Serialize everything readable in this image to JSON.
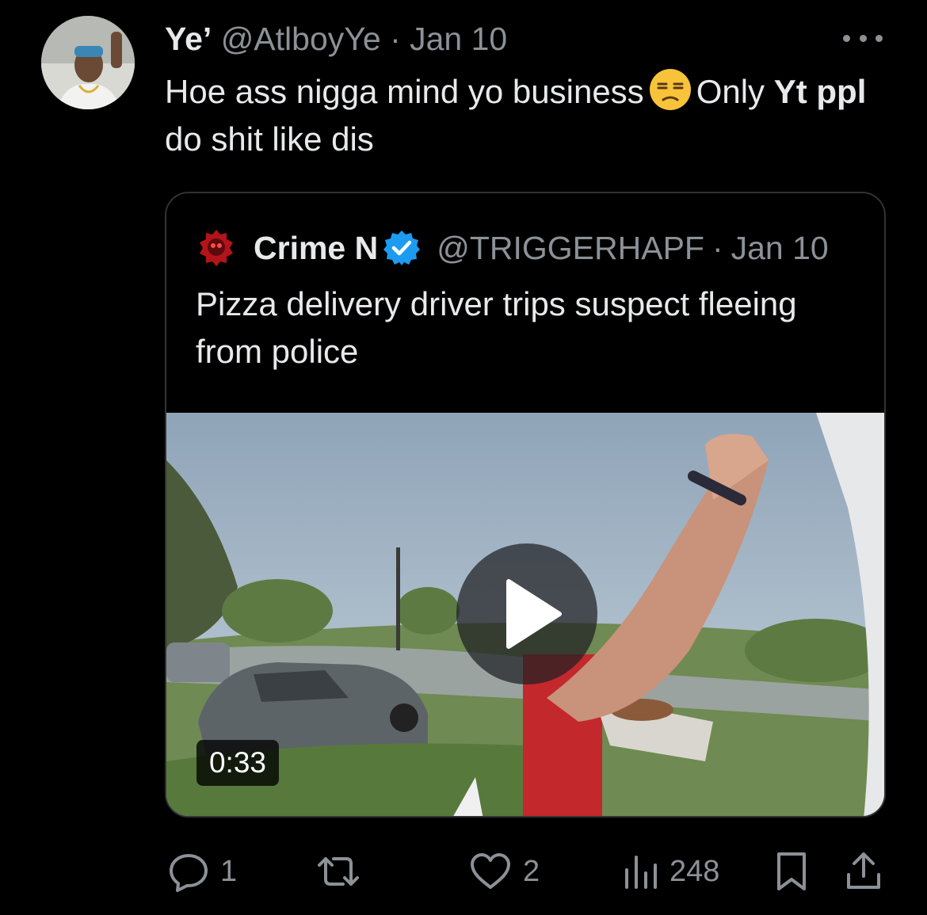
{
  "tweet": {
    "author_name": "Ye’",
    "author_handle": "@AtlboyYe",
    "separator": "·",
    "date": "Jan 10",
    "text_part1": "Hoe ass nigga mind yo business",
    "emoji": "unamused-face-emoji",
    "text_part2": "Only",
    "text_bold1": "Yt",
    "text_bold2": "ppl",
    "text_part3": "do shit like dis"
  },
  "quoted_tweet": {
    "author_name": "Crime N",
    "author_handle": "@TRIGGERHAPF",
    "separator": "·",
    "date": "Jan 10",
    "text": "Pizza delivery driver trips suspect fleeing from police",
    "video_duration": "0:33"
  },
  "actions": {
    "replies": "1",
    "likes": "2",
    "views": "248"
  },
  "icons": [
    "more-icon",
    "verified-badge-icon",
    "play-icon",
    "reply-icon",
    "retweet-icon",
    "like-icon",
    "views-icon",
    "bookmark-icon",
    "share-icon"
  ],
  "colors": {
    "background": "#000000",
    "text": "#e7e9ea",
    "secondary": "#8b9197",
    "verified": "#1d9bf0",
    "border": "#2f3336"
  }
}
